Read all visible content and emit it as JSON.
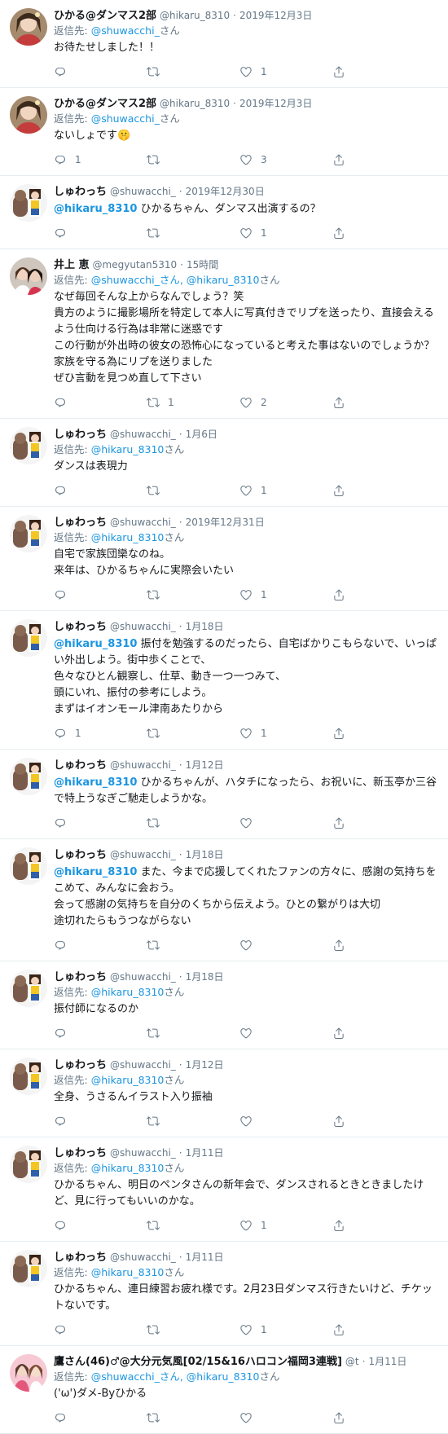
{
  "tweets": [
    {
      "id": "t1",
      "avatar": "avatar-hikaru",
      "name": "ひかる@ダンマス2部",
      "handle": "@hikaru_8310",
      "time": "2019年12月3日",
      "reply_label": "返信先: ",
      "reply_handles": "@shuwacchi_",
      "reply_suffix": "さん",
      "mention": "",
      "text": "お待たせしました！！",
      "counts": {
        "reply": "",
        "retweet": "",
        "like": "1"
      }
    },
    {
      "id": "t2",
      "avatar": "avatar-hikaru",
      "name": "ひかる@ダンマス2部",
      "handle": "@hikaru_8310",
      "time": "2019年12月3日",
      "reply_label": "返信先: ",
      "reply_handles": "@shuwacchi_",
      "reply_suffix": "さん",
      "mention": "",
      "text": "ないしょです🤫",
      "counts": {
        "reply": "1",
        "retweet": "",
        "like": "3"
      }
    },
    {
      "id": "t3",
      "avatar": "avatar-shuwacchi",
      "name": "しゅわっち",
      "handle": "@shuwacchi_",
      "time": "2019年12月30日",
      "reply_label": "",
      "reply_handles": "",
      "reply_suffix": "",
      "mention": "@hikaru_8310",
      "text": " ひかるちゃん、ダンマス出演するの？",
      "counts": {
        "reply": "",
        "retweet": "",
        "like": "1"
      }
    },
    {
      "id": "t4",
      "avatar": "avatar-megyutan",
      "name": "井上 恵",
      "handle": "@megyutan5310",
      "time": "15時間",
      "reply_label": "返信先: ",
      "reply_handles": "@shuwacchi_さん, @hikaru_8310",
      "reply_suffix": "さん",
      "mention": "",
      "text": "なぜ毎回そんな上からなんでしょう？笑\n貴方のように撮影場所を特定して本人に写真付きでリプを送ったり、直接会えるよう仕向ける行為は非常に迷惑です\nこの行動が外出時の彼女の恐怖心になっていると考えた事はないのでしょうか？\n家族を守る為にリプを送りました\nぜひ言動を見つめ直して下さい",
      "counts": {
        "reply": "",
        "retweet": "1",
        "like": "2"
      }
    },
    {
      "id": "t5",
      "avatar": "avatar-shuwacchi",
      "name": "しゅわっち",
      "handle": "@shuwacchi_",
      "time": "1月6日",
      "reply_label": "返信先: ",
      "reply_handles": "@hikaru_8310",
      "reply_suffix": "さん",
      "mention": "",
      "text": "ダンスは表現力",
      "counts": {
        "reply": "",
        "retweet": "",
        "like": "1"
      }
    },
    {
      "id": "t6",
      "avatar": "avatar-shuwacchi",
      "name": "しゅわっち",
      "handle": "@shuwacchi_",
      "time": "2019年12月31日",
      "reply_label": "返信先: ",
      "reply_handles": "@hikaru_8310",
      "reply_suffix": "さん",
      "mention": "",
      "text": "自宅で家族団欒なのね。\n来年は、ひかるちゃんに実際会いたい",
      "counts": {
        "reply": "",
        "retweet": "",
        "like": "1"
      }
    },
    {
      "id": "t7",
      "avatar": "avatar-shuwacchi",
      "name": "しゅわっち",
      "handle": "@shuwacchi_",
      "time": "1月18日",
      "reply_label": "",
      "reply_handles": "",
      "reply_suffix": "",
      "mention": "@hikaru_8310",
      "text": " 振付を勉強するのだったら、自宅ばかりこもらないで、いっぱい外出しよう。街中歩くことで、\n色々なひとん観察し、仕草、動き一つ一つみて、\n頭にいれ、振付の参考にしよう。\nまずはイオンモール津南あたりから",
      "counts": {
        "reply": "1",
        "retweet": "",
        "like": "1"
      }
    },
    {
      "id": "t8",
      "avatar": "avatar-shuwacchi",
      "name": "しゅわっち",
      "handle": "@shuwacchi_",
      "time": "1月12日",
      "reply_label": "",
      "reply_handles": "",
      "reply_suffix": "",
      "mention": "@hikaru_8310",
      "text": " ひかるちゃんが、ハタチになったら、お祝いに、新玉亭か三谷で特上うなぎご馳走しようかな。",
      "counts": {
        "reply": "",
        "retweet": "",
        "like": ""
      }
    },
    {
      "id": "t9",
      "avatar": "avatar-shuwacchi",
      "name": "しゅわっち",
      "handle": "@shuwacchi_",
      "time": "1月18日",
      "reply_label": "",
      "reply_handles": "",
      "reply_suffix": "",
      "mention": "@hikaru_8310",
      "text": " また、今まで応援してくれたファンの方々に、感謝の気持ちをこめて、みんなに会おう。\n会って感謝の気持ちを自分のくちから伝えよう。ひとの繋がりは大切\n途切れたらもうつながらない",
      "counts": {
        "reply": "",
        "retweet": "",
        "like": ""
      }
    },
    {
      "id": "t10",
      "avatar": "avatar-shuwacchi",
      "name": "しゅわっち",
      "handle": "@shuwacchi_",
      "time": "1月18日",
      "reply_label": "返信先: ",
      "reply_handles": "@hikaru_8310",
      "reply_suffix": "さん",
      "mention": "",
      "text": "振付師になるのか",
      "counts": {
        "reply": "",
        "retweet": "",
        "like": ""
      }
    },
    {
      "id": "t11",
      "avatar": "avatar-shuwacchi",
      "name": "しゅわっち",
      "handle": "@shuwacchi_",
      "time": "1月12日",
      "reply_label": "返信先: ",
      "reply_handles": "@hikaru_8310",
      "reply_suffix": "さん",
      "mention": "",
      "text": "全身、うさるんイラスト入り振袖",
      "counts": {
        "reply": "",
        "retweet": "",
        "like": ""
      }
    },
    {
      "id": "t12",
      "avatar": "avatar-shuwacchi",
      "name": "しゅわっち",
      "handle": "@shuwacchi_",
      "time": "1月11日",
      "reply_label": "返信先: ",
      "reply_handles": "@hikaru_8310",
      "reply_suffix": "さん",
      "mention": "",
      "text": "ひかるちゃん、明日のペンタさんの新年会で、ダンスされるときときましたけど、見に行ってもいいのかな。",
      "counts": {
        "reply": "",
        "retweet": "",
        "like": "1"
      }
    },
    {
      "id": "t13",
      "avatar": "avatar-shuwacchi",
      "name": "しゅわっち",
      "handle": "@shuwacchi_",
      "time": "1月11日",
      "reply_label": "返信先: ",
      "reply_handles": "@hikaru_8310",
      "reply_suffix": "さん",
      "mention": "",
      "text": "ひかるちゃん、連日練習お疲れ様です。2月23日ダンマス行きたいけど、チケットないです。",
      "counts": {
        "reply": "",
        "retweet": "",
        "like": "1"
      }
    },
    {
      "id": "t14",
      "avatar": "avatar-taka",
      "name": "鷹さん(46)♂@大分元気風[02/15&16ハロコン福岡3連戦]",
      "handle": "@t",
      "time": "1月11日",
      "reply_label": "返信先: ",
      "reply_handles": "@shuwacchi_さん, @hikaru_8310",
      "reply_suffix": "さん",
      "mention": "",
      "text": "('ω')ダメ-Byひかる",
      "counts": {
        "reply": "",
        "retweet": "",
        "like": ""
      }
    }
  ],
  "icons": {
    "reply": "reply-icon",
    "retweet": "retweet-icon",
    "like": "heart-icon",
    "share": "share-icon"
  },
  "colors": {
    "link": "#1b95e0",
    "muted": "#657786",
    "divider": "#e6ecf0"
  }
}
